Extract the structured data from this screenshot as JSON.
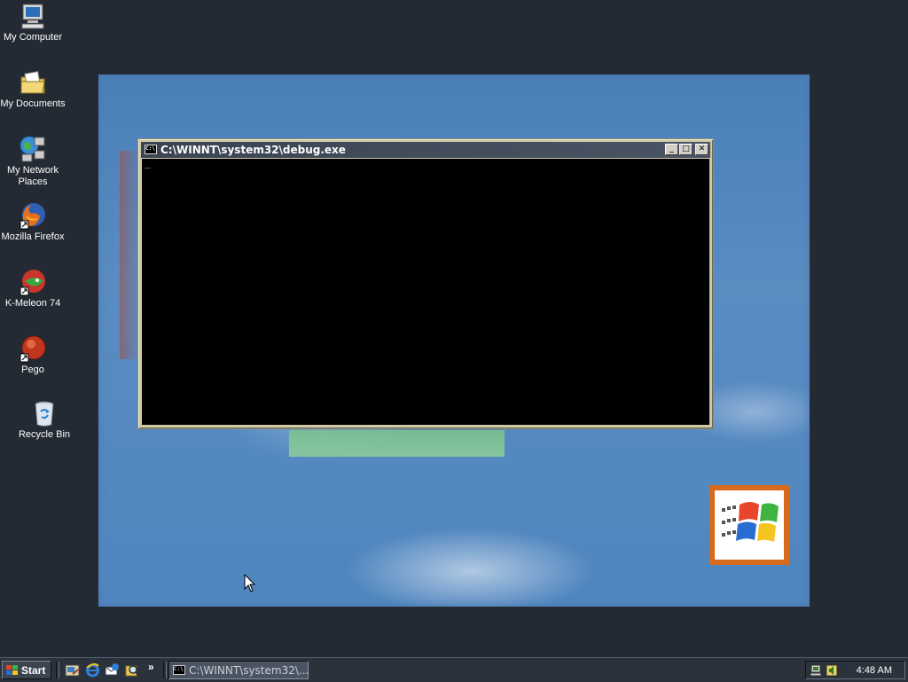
{
  "desktop": {
    "icons": [
      {
        "label": "My Computer",
        "icon": "computer-icon"
      },
      {
        "label": "My Documents",
        "icon": "folder-documents-icon"
      },
      {
        "label": "My Network Places",
        "icon": "network-places-icon"
      },
      {
        "label": "Mozilla Firefox",
        "icon": "firefox-icon"
      },
      {
        "label": "K-Meleon 74",
        "icon": "k-meleon-icon"
      },
      {
        "label": "Pego",
        "icon": "pego-icon"
      },
      {
        "label": "Recycle Bin",
        "icon": "recycle-bin-icon"
      }
    ]
  },
  "console": {
    "title": "C:\\WINNT\\system32\\debug.exe",
    "icon_text": "C:\\",
    "minimize": "_",
    "maximize": "□",
    "close": "✕",
    "cursor": "_"
  },
  "taskbar": {
    "start_label": "Start",
    "overflow": "»",
    "task_label": "C:\\WINNT\\system32\\...",
    "task_icon_text": "C:\\",
    "clock": "4:48 AM"
  },
  "colors": {
    "taskbar": "#2b323c",
    "desktop_background": "#232a33",
    "console_bg": "#000000",
    "window_frame": "#cfc9a8"
  }
}
